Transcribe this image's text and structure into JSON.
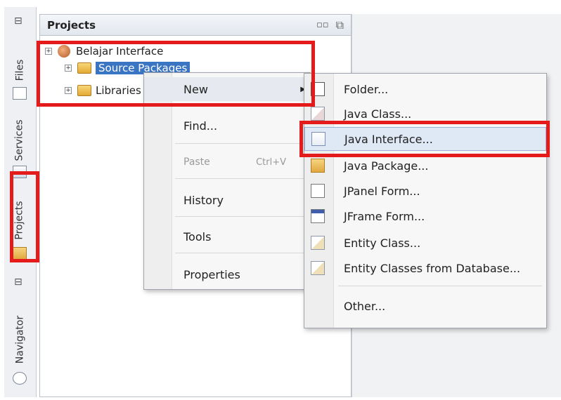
{
  "side_tabs": [
    {
      "label": "Files",
      "icon": "files-icon"
    },
    {
      "label": "Services",
      "icon": "services-icon"
    },
    {
      "label": "Projects",
      "icon": "projects-icon"
    },
    {
      "label": "Navigator",
      "icon": "navigator-icon"
    }
  ],
  "panel": {
    "title": "Projects",
    "minimize_glyph": "▫▫",
    "restore_glyph": "⧉"
  },
  "tree": {
    "project": "Belajar Interface",
    "source_packages": "Source Packages",
    "libraries": "Libraries",
    "expander_glyph": "+"
  },
  "context_menu": {
    "items": [
      {
        "label": "New",
        "has_submenu": true,
        "arrow": "▶"
      },
      {
        "label": "Find..."
      },
      {
        "label": "Paste",
        "shortcut": "Ctrl+V",
        "disabled": true
      },
      {
        "label": "History",
        "has_submenu": true
      },
      {
        "label": "Tools",
        "has_submenu": true
      },
      {
        "label": "Properties"
      }
    ]
  },
  "submenu": {
    "items": [
      {
        "label": "Folder...",
        "icon": "folder-icon"
      },
      {
        "label": "Java Class...",
        "icon": "java-class-icon"
      },
      {
        "label": "Java Interface...",
        "icon": "java-interface-icon",
        "highlighted": true
      },
      {
        "label": "Java Package...",
        "icon": "java-package-icon"
      },
      {
        "label": "JPanel Form...",
        "icon": "jpanel-form-icon"
      },
      {
        "label": "JFrame Form...",
        "icon": "jframe-form-icon"
      },
      {
        "label": "Entity Class...",
        "icon": "entity-class-icon"
      },
      {
        "label": "Entity Classes from Database...",
        "icon": "entity-database-icon"
      },
      {
        "label": "Other..."
      }
    ]
  },
  "colors": {
    "annotation_red": "#e51b1b",
    "selection_blue": "#3a75c4"
  }
}
